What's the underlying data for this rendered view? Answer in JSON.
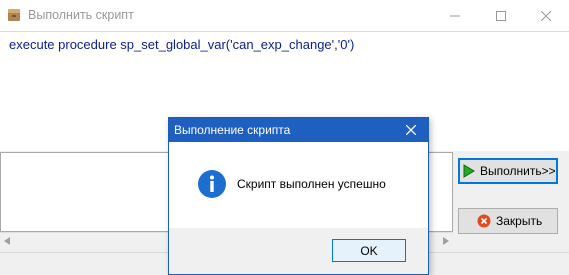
{
  "main_window": {
    "title": "Выполнить скрипт",
    "editor_text": "execute procedure sp_set_global_var('can_exp_change','0')",
    "buttons": {
      "run_label": "Выполнить>>",
      "close_label": "Закрыть"
    }
  },
  "dialog": {
    "title": "Выполнение скрипта",
    "message": "Скрипт выполнен успешно",
    "ok_label": "OK"
  },
  "icons": {
    "app": "database-icon",
    "run": "play-arrow-icon",
    "close": "close-circle-icon",
    "info": "info-icon"
  },
  "colors": {
    "dialog_title_bg": "#1f5fbf",
    "editor_text": "#0a1f8f",
    "focus_border": "#0078d7"
  }
}
